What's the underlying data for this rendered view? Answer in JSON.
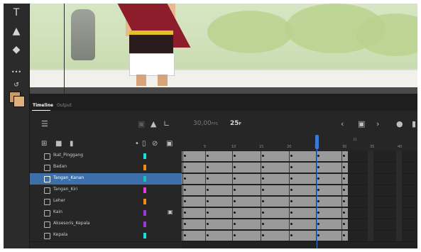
{
  "toolbar": {
    "text_tool": "T",
    "more": "•••"
  },
  "panel": {
    "tabs": [
      {
        "label": "Timeline",
        "active": true
      },
      {
        "label": "Output",
        "active": false
      }
    ]
  },
  "controls": {
    "fps_value": "30,00",
    "fps_unit": "FPS",
    "current_frame": "25",
    "current_frame_unit": "F"
  },
  "ruler": {
    "subframe": "31",
    "ticks": [
      "5",
      "10",
      "15",
      "20",
      "25",
      "30",
      "35",
      "40"
    ]
  },
  "layers": [
    {
      "name": "Ikat_Pinggang",
      "color": "#19e0e0",
      "locked": false,
      "selected": false
    },
    {
      "name": "Badan",
      "color": "#f08a1c",
      "locked": false,
      "selected": false
    },
    {
      "name": "Tangan_Kanan",
      "color": "#19c2b0",
      "locked": false,
      "selected": true
    },
    {
      "name": "Tangan_Kiri",
      "color": "#e83ad8",
      "locked": false,
      "selected": false
    },
    {
      "name": "Leher",
      "color": "#f08a1c",
      "locked": false,
      "selected": false
    },
    {
      "name": "Kain",
      "color": "#9b3ad8",
      "locked": true,
      "selected": false
    },
    {
      "name": "Aksesoris_Kepala",
      "color": "#9b3ad8",
      "locked": false,
      "selected": false
    },
    {
      "name": "Kepala",
      "color": "#19e0e0",
      "locked": false,
      "selected": false
    }
  ]
}
